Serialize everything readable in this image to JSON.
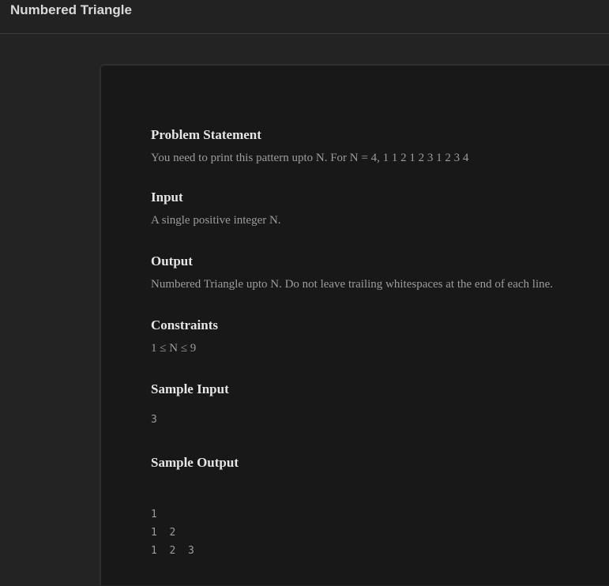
{
  "app": {
    "title": "Numbered Triangle"
  },
  "problem": {
    "statement_heading": "Problem Statement",
    "statement_text": "You need to print this pattern upto N. For N = 4, 1 1 2 1 2 3 1 2 3 4",
    "input_heading": "Input",
    "input_text": "A single positive integer N.",
    "output_heading": "Output",
    "output_text": "Numbered Triangle upto N. Do not leave trailing whitespaces at the end of each line.",
    "constraints_heading": "Constraints",
    "constraints_text": "1 ≤ N ≤ 9",
    "sample_input_heading": "Sample Input",
    "sample_input": "3",
    "sample_output_heading": "Sample Output",
    "sample_output": [
      "1",
      "1 2",
      "1 2 3"
    ]
  }
}
